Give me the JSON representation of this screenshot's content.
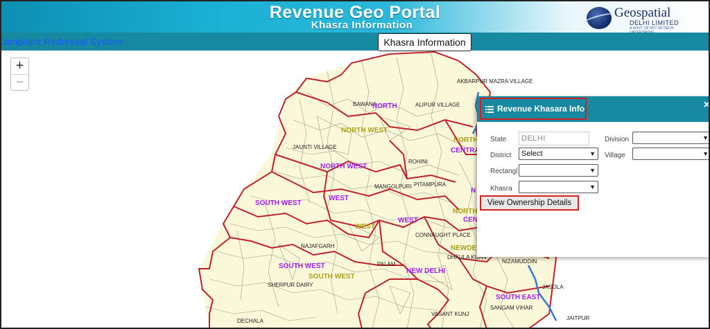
{
  "header": {
    "title": "Revenue Geo Portal",
    "subtitle": "Khasra Information",
    "logo_brand": "Geospatial",
    "logo_sub": "DELHI LIMITED",
    "logo_tag": "A GOVT. OF NCT OF DELHI UNDERTAKING"
  },
  "navbar": {
    "link": "Complaint Redressal System"
  },
  "khasra_button": "Khasra Information",
  "zoom": {
    "plus": "+",
    "minus": "−"
  },
  "map_labels": [
    {
      "id": "akbarpur",
      "text": "AKBARPUR MAZRA VILLAGE",
      "style": "dark"
    },
    {
      "id": "bawana",
      "text": "BAWANA",
      "style": "dark"
    },
    {
      "id": "north",
      "text": "NORTH",
      "style": "purple"
    },
    {
      "id": "alipur",
      "text": "ALIPUR VILLAGE",
      "style": "dark"
    },
    {
      "id": "north-west-1",
      "text": "NORTH WEST",
      "style": "olive"
    },
    {
      "id": "jaunti",
      "text": "JAUNTI VILLAGE",
      "style": "dark"
    },
    {
      "id": "north-west-2",
      "text": "NORTH WEST",
      "style": "purple"
    },
    {
      "id": "rohini",
      "text": "ROHINI",
      "style": "dark"
    },
    {
      "id": "mangolpuri",
      "text": "MANGOLPURI",
      "style": "dark"
    },
    {
      "id": "pitampura",
      "text": "PITAMPURA",
      "style": "dark"
    },
    {
      "id": "west-1",
      "text": "WEST",
      "style": "purple"
    },
    {
      "id": "south-west-1",
      "text": "SOUTH WEST",
      "style": "purple"
    },
    {
      "id": "west-2",
      "text": "WEST",
      "style": "olive"
    },
    {
      "id": "west-3",
      "text": "WEST",
      "style": "purple"
    },
    {
      "id": "connaught",
      "text": "CONNAUGHT PLACE",
      "style": "dark"
    },
    {
      "id": "najafgarh",
      "text": "NAJAFGARH",
      "style": "dark"
    },
    {
      "id": "palam",
      "text": "PALAM",
      "style": "dark"
    },
    {
      "id": "new-delhi",
      "text": "NEW DELHI",
      "style": "purple"
    },
    {
      "id": "newde",
      "text": "NEWDE",
      "style": "olive"
    },
    {
      "id": "dhaula",
      "text": "DHAULA KUAN",
      "style": "dark"
    },
    {
      "id": "nizamuddin",
      "text": "NIZAMUDDIN",
      "style": "dark"
    },
    {
      "id": "south-west-2",
      "text": "SOUTH WEST",
      "style": "purple"
    },
    {
      "id": "south-west-3",
      "text": "SOUTH WEST",
      "style": "olive"
    },
    {
      "id": "sherpur",
      "text": "SHERPUR DAIRY",
      "style": "dark"
    },
    {
      "id": "south-east",
      "text": "SOUTH EAST",
      "style": "purple"
    },
    {
      "id": "jasola",
      "text": "JASOLA",
      "style": "dark"
    },
    {
      "id": "vasant",
      "text": "VASANT KUNJ",
      "style": "dark"
    },
    {
      "id": "sangam",
      "text": "SANGAM VIHAR",
      "style": "dark"
    },
    {
      "id": "jaitpur",
      "text": "JAITPUR",
      "style": "dark"
    },
    {
      "id": "dechala",
      "text": "DECHALA",
      "style": "dark"
    },
    {
      "id": "north-east",
      "text": "NORTH",
      "style": "olive"
    },
    {
      "id": "central-1",
      "text": "CENTRA",
      "style": "purple"
    },
    {
      "id": "north-2",
      "text": "NORTH",
      "style": "olive"
    },
    {
      "id": "cen",
      "text": "CEN",
      "style": "purple"
    },
    {
      "id": "na",
      "text": "N",
      "style": "purple"
    }
  ],
  "panel": {
    "title": "Revenue Khasara Info",
    "close": "×",
    "state_label": "State",
    "state_value": "DELHI",
    "division_label": "Division",
    "district_label": "District",
    "district_value": "Select",
    "village_label": "Village",
    "rectangle_label": "Rectangl",
    "khasra_label": "Khasra",
    "view_button": "View Ownership Details"
  }
}
